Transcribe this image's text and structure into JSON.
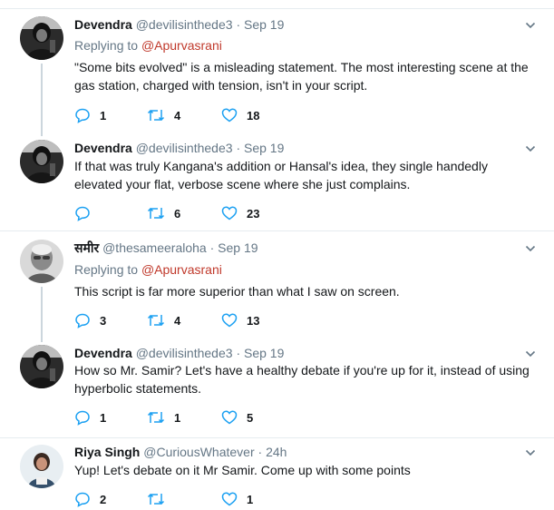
{
  "tweets": [
    {
      "name": "Devendra",
      "handle": "@devilisinthede3",
      "dot": "·",
      "time": "Sep 19",
      "reply_prefix": "Replying to",
      "reply_to": "@Apurvasrani",
      "text": "\"Some bits evolved\" is a misleading statement. The most interesting scene at the gas station, charged with tension, isn't in your script.",
      "replies": "1",
      "retweets": "4",
      "likes": "18"
    },
    {
      "name": "Devendra",
      "handle": "@devilisinthede3",
      "dot": "·",
      "time": "Sep 19",
      "text": "If that was truly Kangana's addition or Hansal's idea, they single handedly elevated your flat, verbose scene where she just complains.",
      "replies": "",
      "retweets": "6",
      "likes": "23"
    },
    {
      "name": "समीर",
      "handle": "@thesameeraloha",
      "dot": "·",
      "time": "Sep 19",
      "reply_prefix": "Replying to",
      "reply_to": "@Apurvasrani",
      "text": "This script is far more superior than what I saw on screen.",
      "replies": "3",
      "retweets": "4",
      "likes": "13"
    },
    {
      "name": "Devendra",
      "handle": "@devilisinthede3",
      "dot": "·",
      "time": "Sep 19",
      "text": "How so Mr. Samir? Let's have a healthy debate if you're up for it, instead of using hyperbolic statements.",
      "replies": "1",
      "retweets": "1",
      "likes": "5"
    },
    {
      "name": "Riya Singh",
      "handle": "@CuriousWhatever",
      "dot": "·",
      "time": "24h",
      "text": "Yup! Let's debate on it Mr Samir. Come up with some points",
      "replies": "2",
      "retweets": "",
      "likes": "1"
    }
  ],
  "colors": {
    "text": "#14171a",
    "muted": "#657786",
    "mention": "#c0392b",
    "divider": "#e6ecf0",
    "thread_line": "#ccd6dd",
    "icon": "#1da1f2"
  }
}
